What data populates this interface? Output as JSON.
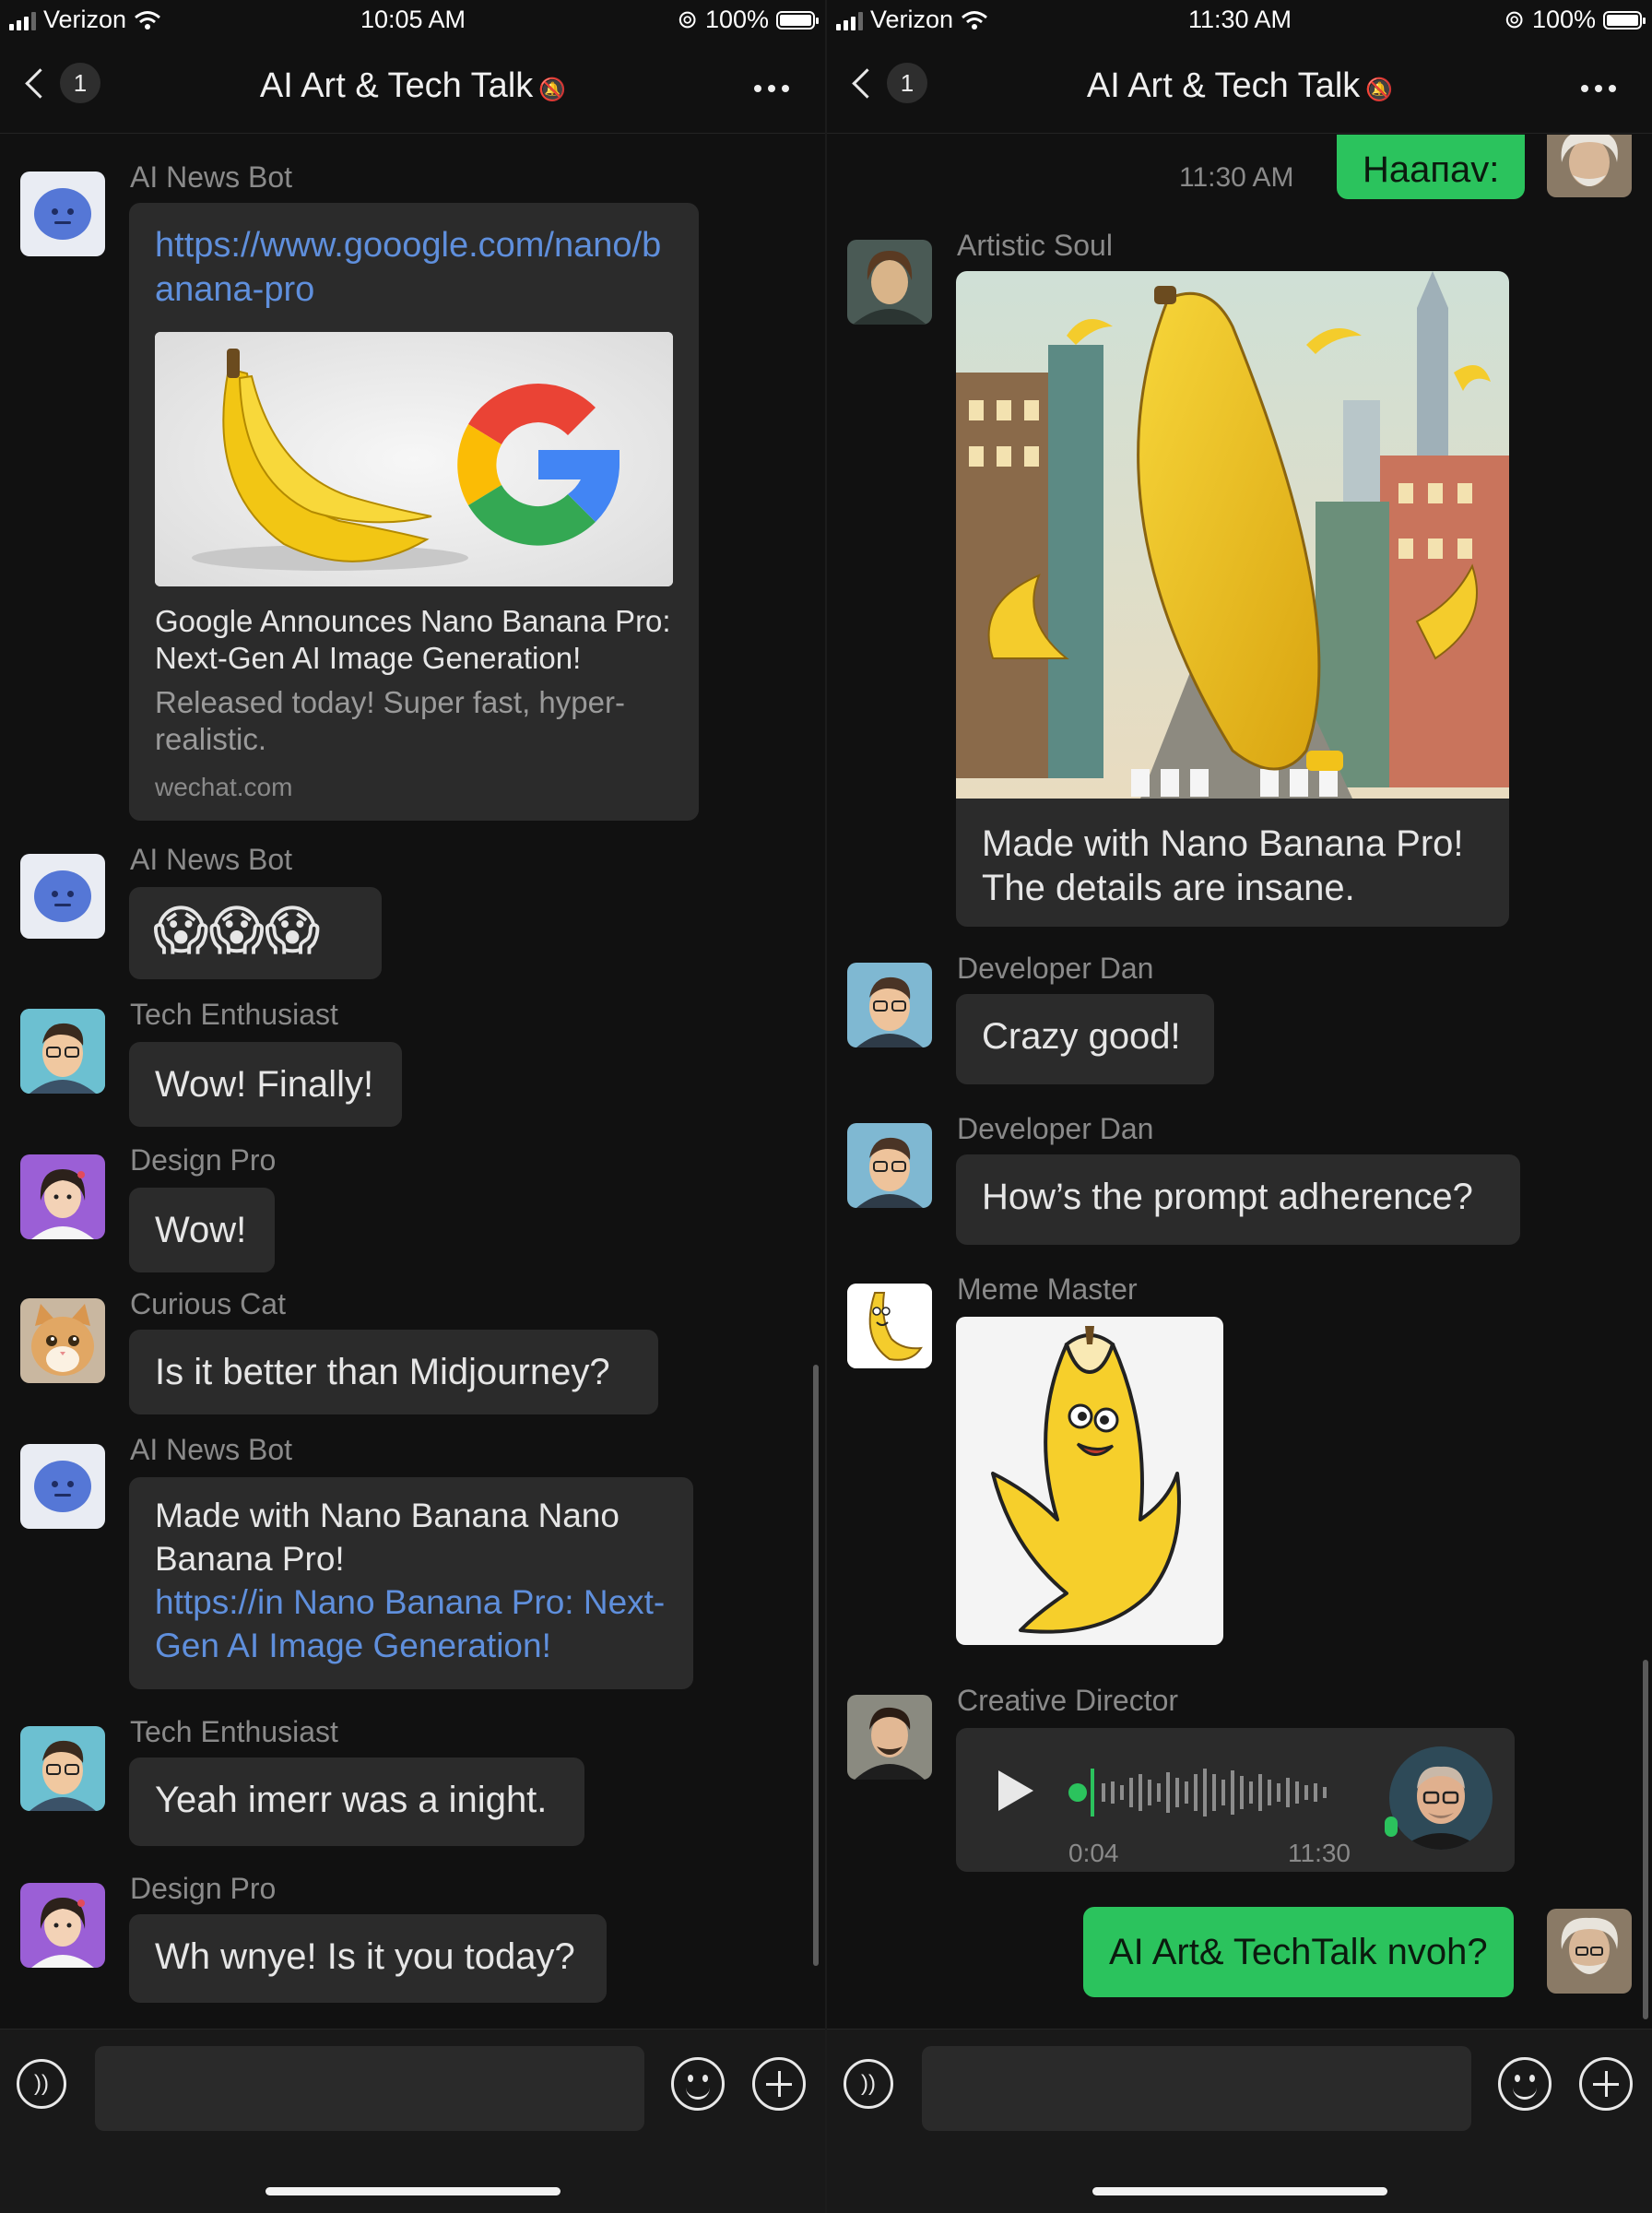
{
  "left": {
    "status": {
      "carrier": "Verizon",
      "time": "10:05 AM",
      "battery": "100%"
    },
    "nav": {
      "back_count": "1",
      "title": "AI Art & Tech Talk"
    },
    "messages": [
      {
        "sender": "AI News Bot",
        "card": {
          "url": "https://www.gooogle.com/nano/banana-pro",
          "title": "Google Announces Nano Banana Pro: Next-Gen AI Image Generation!",
          "desc": "Released today! Super fast, hyper-realistic.",
          "source": "wechat.com"
        }
      },
      {
        "sender": "AI News Bot",
        "text": "😱😱😱"
      },
      {
        "sender": "Tech Enthusiast",
        "text": "Wow! Finally!"
      },
      {
        "sender": "Design Pro",
        "text": "Wow!"
      },
      {
        "sender": "Curious Cat",
        "text": "Is it better than Midjourney?"
      },
      {
        "sender": "AI News Bot",
        "text": "Made with Nano Banana Nano Banana Pro!",
        "link": "https://in Nano Banana Pro: Next-Gen AI Image Generation!"
      },
      {
        "sender": "Tech Enthusiast",
        "text": "Yeah imerr was a inight."
      },
      {
        "sender": "Design Pro",
        "text": "Wh wnye! Is it you today?"
      }
    ]
  },
  "right": {
    "status": {
      "carrier": "Verizon",
      "time": "11:30 AM",
      "battery": "100%"
    },
    "nav": {
      "back_count": "1",
      "title": "AI Art & Tech Talk"
    },
    "timestamp": "11:30 AM",
    "top_mine": "Haaпav:",
    "messages": [
      {
        "sender": "Artistic Soul",
        "caption": "Made with Nano Banana Pro! The details are insane."
      },
      {
        "sender": "Developer Dan",
        "text": "Crazy good!"
      },
      {
        "sender": "Developer Dan",
        "text": "How’s the prompt adherence?"
      },
      {
        "sender": "Meme Master"
      },
      {
        "sender": "Creative Director",
        "voice": {
          "duration": "0:04",
          "time": "11:30"
        }
      }
    ],
    "bottom_mine": "AI Art& TechTalk nvoh?"
  },
  "colors": {
    "background": "#111111",
    "bubble": "#2b2b2b",
    "mine": "#2bc35d",
    "link": "#5f8fdc"
  }
}
